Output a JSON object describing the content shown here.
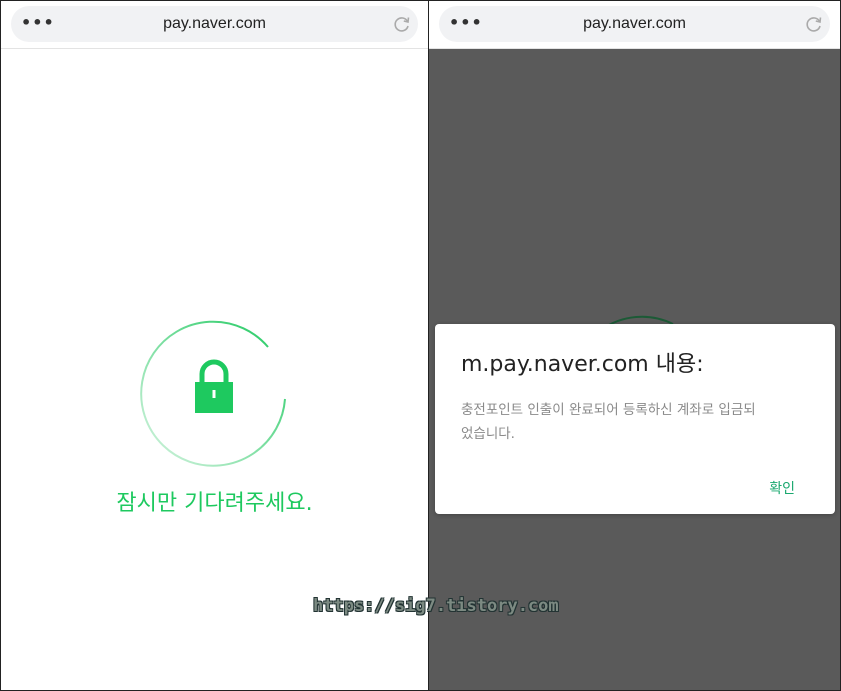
{
  "left": {
    "urlbar": {
      "menu_icon": "more-dots-icon",
      "url": "pay.naver.com",
      "reload_icon": "reload-icon"
    },
    "lock_icon": "lock-icon",
    "loading_text": "잠시만 기다려주세요."
  },
  "right": {
    "urlbar": {
      "menu_icon": "more-dots-icon",
      "url": "pay.naver.com",
      "reload_icon": "reload-icon"
    },
    "dialog": {
      "title": "m.pay.naver.com 내용:",
      "message": "충전포인트 인출이 완료되어 등록하신 계좌로 입금되었습니다.",
      "confirm_label": "확인"
    }
  },
  "watermark": "https://sig7.tistory.com",
  "colors": {
    "accent_green": "#1ec95f",
    "overlay": "#5a5a5a",
    "confirm": "#1aa86f"
  }
}
